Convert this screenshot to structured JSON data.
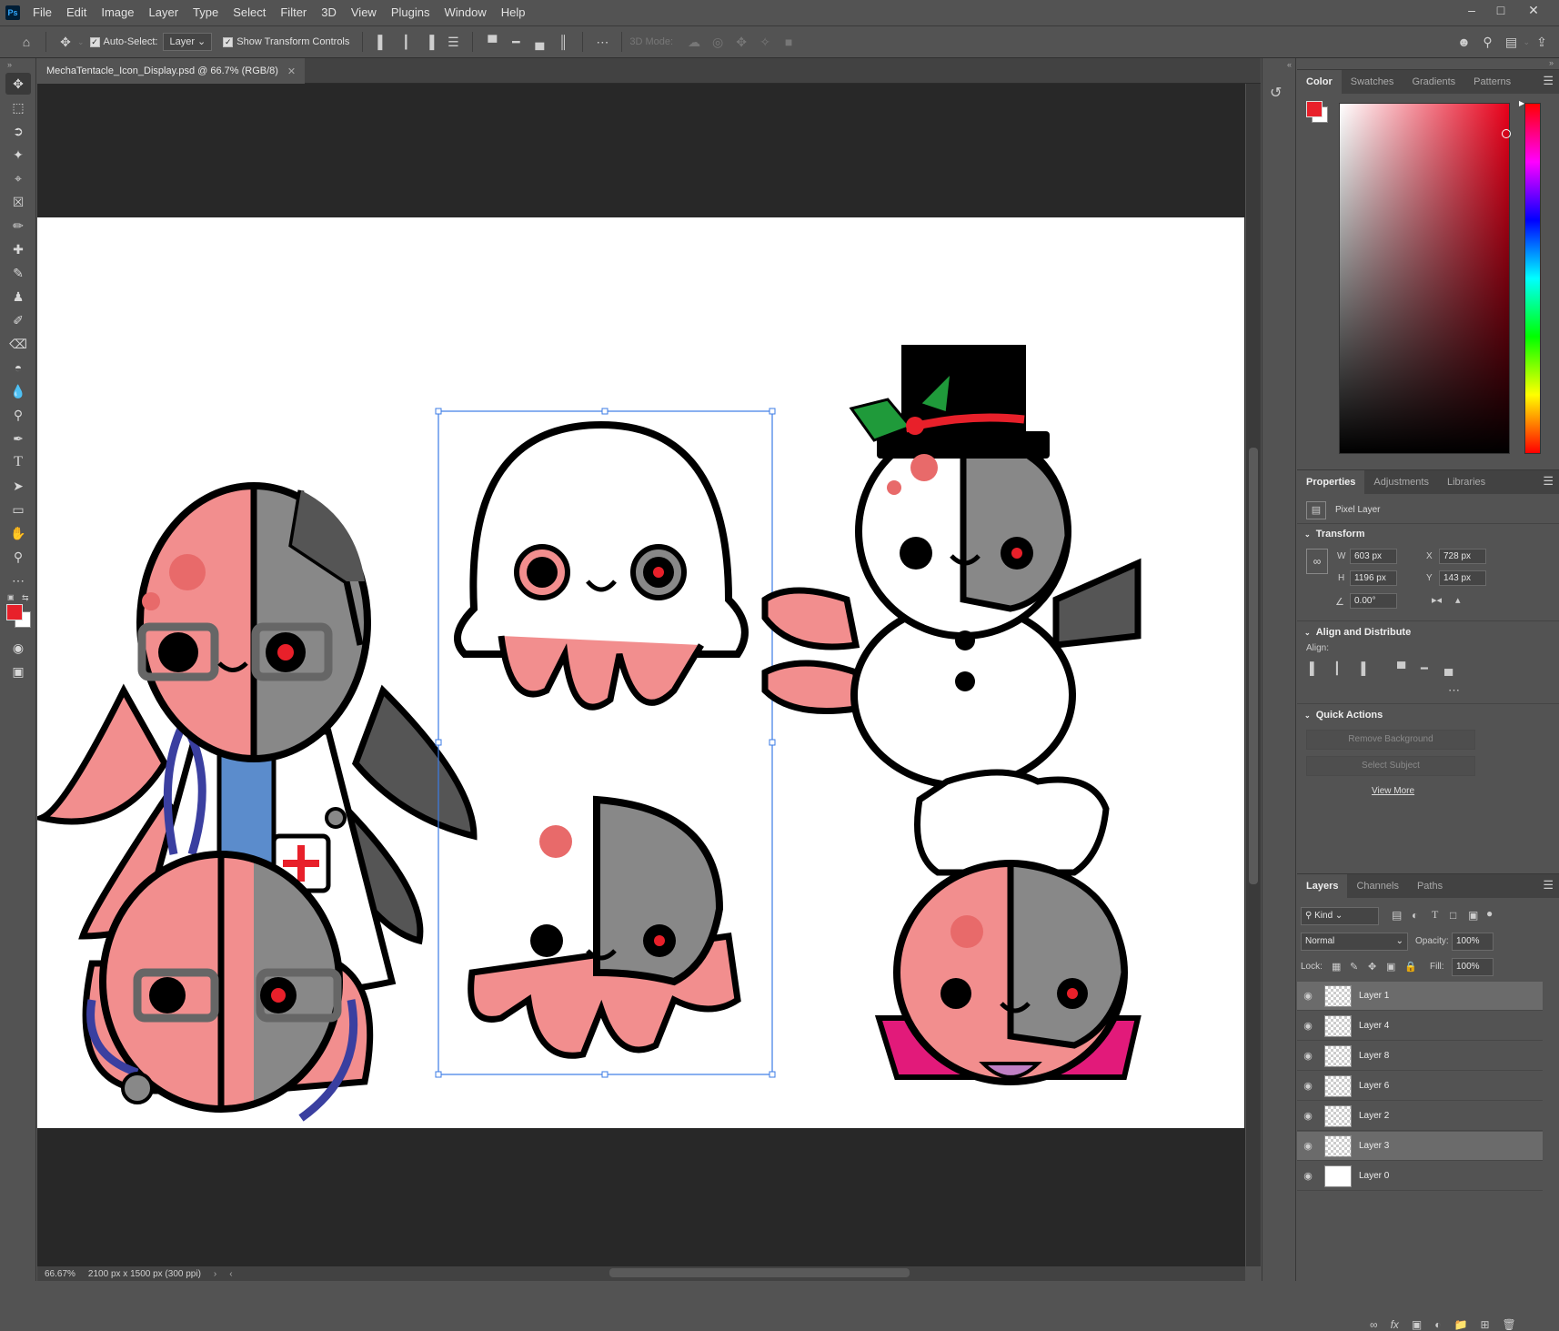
{
  "app": {
    "logo": "Ps"
  },
  "menu": [
    "File",
    "Edit",
    "Image",
    "Layer",
    "Type",
    "Select",
    "Filter",
    "3D",
    "View",
    "Plugins",
    "Window",
    "Help"
  ],
  "options_bar": {
    "auto_select_label": "Auto-Select:",
    "auto_select_value": "Layer",
    "show_transform_label": "Show Transform Controls",
    "mode_3d_label": "3D Mode:"
  },
  "document": {
    "tab_title": "MechaTentacle_Icon_Display.psd @ 66.7% (RGB/8)",
    "zoom": "66.67%",
    "info": "2100 px x 1500 px (300 ppi)"
  },
  "colors": {
    "foreground": "#e8202a",
    "background": "#ffffff",
    "accent": "#31a8ff"
  },
  "color_panel": {
    "tabs": [
      "Color",
      "Swatches",
      "Gradients",
      "Patterns"
    ],
    "active": "Color"
  },
  "properties_panel": {
    "tabs": [
      "Properties",
      "Adjustments",
      "Libraries"
    ],
    "layer_type": "Pixel Layer",
    "transform_title": "Transform",
    "w_label": "W",
    "w": "603 px",
    "h_label": "H",
    "h": "1196 px",
    "x_label": "X",
    "x": "728 px",
    "y_label": "Y",
    "y": "143 px",
    "angle": "0.00°",
    "align_title": "Align and Distribute",
    "align_label": "Align:",
    "quick_actions_title": "Quick Actions",
    "remove_bg": "Remove Background",
    "select_subject": "Select Subject",
    "view_more": "View More"
  },
  "layers_panel": {
    "tabs": [
      "Layers",
      "Channels",
      "Paths"
    ],
    "kind": "Kind",
    "blend_mode": "Normal",
    "opacity_label": "Opacity:",
    "opacity": "100%",
    "lock_label": "Lock:",
    "fill_label": "Fill:",
    "fill": "100%",
    "layers": [
      {
        "name": "Layer 1",
        "selected": true
      },
      {
        "name": "Layer 4",
        "selected": false
      },
      {
        "name": "Layer 8",
        "selected": false
      },
      {
        "name": "Layer 6",
        "selected": false
      },
      {
        "name": "Layer 2",
        "selected": false
      },
      {
        "name": "Layer 3",
        "selected": true
      },
      {
        "name": "Layer 0",
        "selected": false
      }
    ]
  }
}
